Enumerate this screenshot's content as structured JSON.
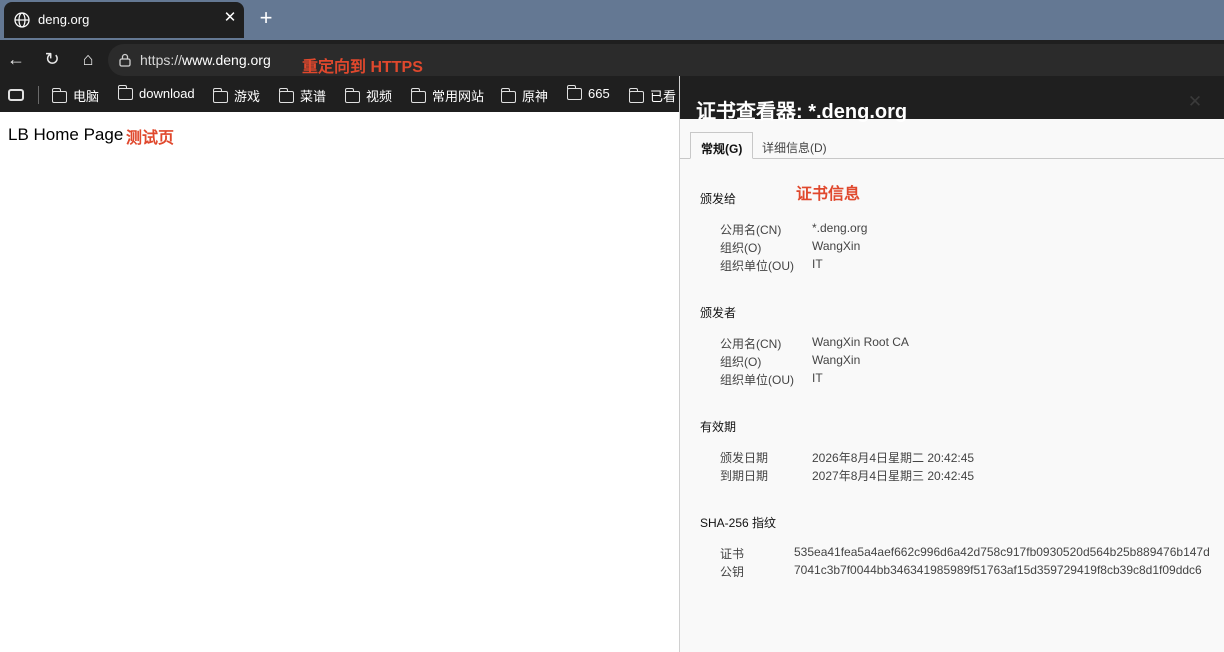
{
  "browser": {
    "tab": {
      "title": "deng.org",
      "close": "✕"
    },
    "new_tab": "+",
    "nav": {
      "back": "←",
      "reload": "↻",
      "home": "⌂"
    },
    "address": {
      "scheme": "https://",
      "host": "www.deng.org"
    },
    "bookmarks": [
      "电脑",
      "download",
      "游戏",
      "菜谱",
      "视频",
      "常用网站",
      "原神",
      "665",
      "已看"
    ]
  },
  "annotations": {
    "redirect": "重定向到 HTTPS",
    "test_page": "测试页",
    "cert_info": "证书信息"
  },
  "page": {
    "title": "LB Home Page"
  },
  "cert_viewer": {
    "title": "证书查看器: *.deng.org",
    "close": "✕",
    "tabs": [
      "常规(G)",
      "详细信息(D)"
    ],
    "issued_to": {
      "heading": "颁发给",
      "rows": [
        {
          "label": "公用名(CN)",
          "value": "*.deng.org"
        },
        {
          "label": "组织(O)",
          "value": "WangXin"
        },
        {
          "label": "组织单位(OU)",
          "value": "IT"
        }
      ]
    },
    "issued_by": {
      "heading": "颁发者",
      "rows": [
        {
          "label": "公用名(CN)",
          "value": "WangXin Root CA"
        },
        {
          "label": "组织(O)",
          "value": "WangXin"
        },
        {
          "label": "组织单位(OU)",
          "value": "IT"
        }
      ]
    },
    "validity": {
      "heading": "有效期",
      "rows": [
        {
          "label": "颁发日期",
          "value": "2026年8月4日星期二 20:42:45"
        },
        {
          "label": "到期日期",
          "value": "2027年8月4日星期三 20:42:45"
        }
      ]
    },
    "fingerprints": {
      "heading": "SHA-256 指纹",
      "rows": [
        {
          "label": "证书",
          "value": "535ea41fea5a4aef662c996d6a42d758c917fb0930520d564b25b889476b147d"
        },
        {
          "label": "公钥",
          "value": "7041c3b7f0044bb346341985989f51763af15d359729419f8cb39c8d1f09ddc6"
        }
      ]
    }
  }
}
